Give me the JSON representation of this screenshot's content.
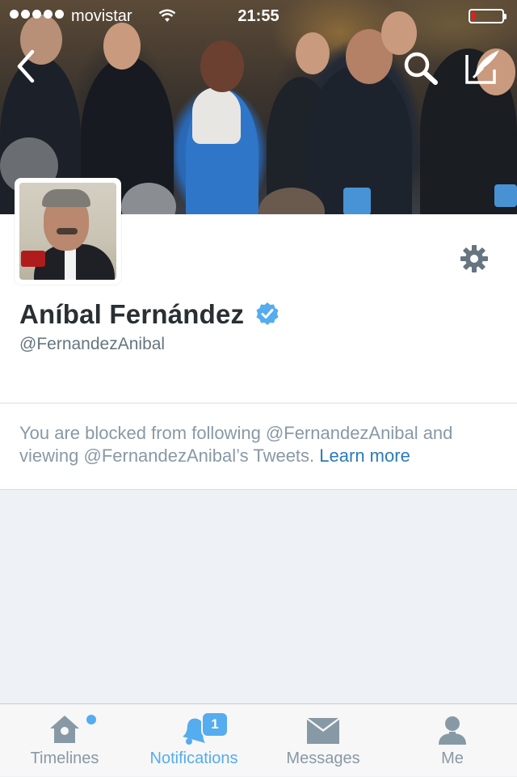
{
  "status_bar": {
    "carrier": "movistar",
    "time": "21:55",
    "battery_level": 0.1
  },
  "header": {
    "back_icon": "chevron-left-icon",
    "search_icon": "search-icon",
    "compose_icon": "compose-tweet-icon"
  },
  "profile": {
    "name": "Aníbal Fernández",
    "handle": "@FernandezAnibal",
    "verified": true,
    "settings_icon": "gear-icon"
  },
  "blocked_notice": {
    "text": "You are blocked from following @FernandezAnibal and viewing @FernandezAnibal’s Tweets.",
    "link": "Learn more"
  },
  "tabs": [
    {
      "label": "Timelines",
      "icon": "home-icon",
      "active": false
    },
    {
      "label": "Notifications",
      "icon": "bell-icon",
      "active": true,
      "badge": "1"
    },
    {
      "label": "Messages",
      "icon": "envelope-icon",
      "active": false
    },
    {
      "label": "Me",
      "icon": "person-icon",
      "active": false
    }
  ],
  "colors": {
    "accent": "#55acee",
    "link": "#2b7bb9",
    "text": "#292f33",
    "muted": "#8899a6",
    "background": "#eef1f5"
  }
}
